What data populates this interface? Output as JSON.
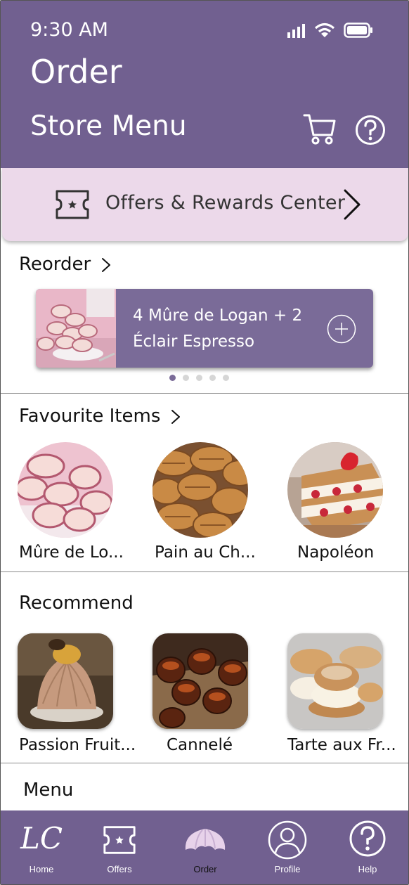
{
  "status": {
    "time": "9:30 AM"
  },
  "header": {
    "title": "Order",
    "subtitle": "Store Menu"
  },
  "offers": {
    "label": "Offers & Rewards Center"
  },
  "reorder": {
    "title": "Reorder",
    "card_line1": "4 Mûre de Logan + 2",
    "card_line2": "Éclair Espresso",
    "page_count": 5,
    "active_page": 1
  },
  "favourites": {
    "title": "Favourite Items",
    "items": [
      {
        "label": "Mûre de Lo..."
      },
      {
        "label": "Pain au Ch..."
      },
      {
        "label": "Napoléon"
      }
    ]
  },
  "recommend": {
    "title": "Recommend",
    "items": [
      {
        "label": "Passion Fruit..."
      },
      {
        "label": "Cannelé"
      },
      {
        "label": "Tarte aux Fr..."
      }
    ]
  },
  "menu": {
    "title": "Menu"
  },
  "nav": {
    "items": [
      {
        "label": "Home",
        "logo": "LC"
      },
      {
        "label": "Offers"
      },
      {
        "label": "Order"
      },
      {
        "label": "Profile"
      },
      {
        "label": "Help"
      }
    ],
    "active": "Order"
  },
  "colors": {
    "primary": "#716090",
    "offers_bg": "#ecd9ea",
    "card": "#7a6b98"
  }
}
